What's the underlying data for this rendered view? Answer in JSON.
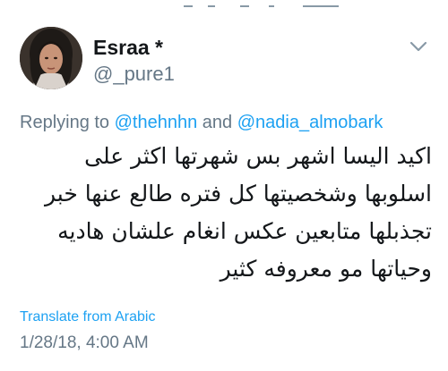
{
  "author": {
    "display_name": "Esraa *",
    "handle": "@_pure1"
  },
  "reply": {
    "prefix": "Replying to ",
    "mention_1": "@thehnhn",
    "conjunction": " and ",
    "mention_2": "@nadia_almobark"
  },
  "tweet": {
    "lines": [
      "اكيد اليسا اشهر بس شهرتها اكثر على",
      "اسلوبها وشخصيتها كل فتره طالع عنها خبر",
      "تجذبلها متابعين عكس انغام علشان هاديه",
      "وحياتها مو معروفه كثير"
    ]
  },
  "translate_label": "Translate from Arabic",
  "timestamp": "1/28/18, 4:00 AM",
  "icons": {
    "more_menu": "chevron-down-icon",
    "avatar": "profile-photo"
  },
  "colors": {
    "link": "#1da1f2",
    "secondary_text": "#657786",
    "primary_text": "#14171a",
    "background": "#ffffff"
  }
}
